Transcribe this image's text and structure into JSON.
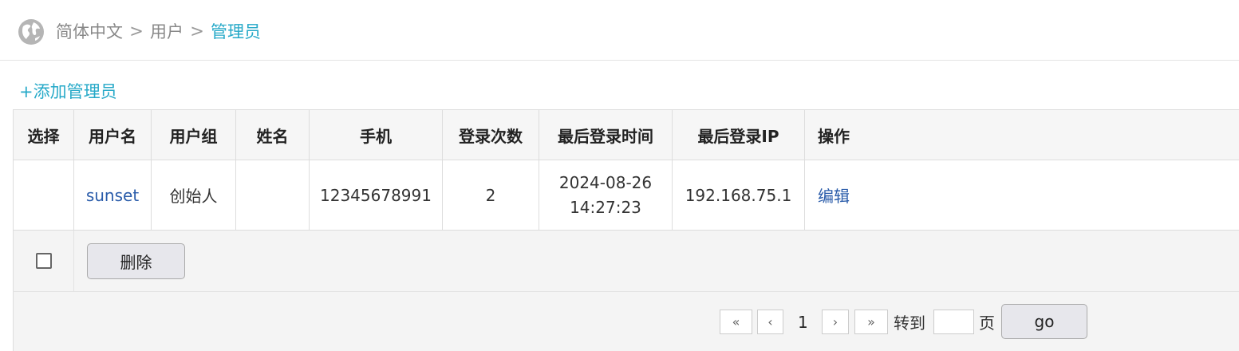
{
  "breadcrumb": {
    "icon": "globe-icon",
    "items": [
      "简体中文",
      "用户",
      "管理员"
    ],
    "separator": ">"
  },
  "add_admin_link": "+添加管理员",
  "table": {
    "headers": [
      "选择",
      "用户名",
      "用户组",
      "姓名",
      "手机",
      "登录次数",
      "最后登录时间",
      "最后登录IP",
      "操作"
    ],
    "rows": [
      {
        "select": "",
        "username": "sunset",
        "group": "创始人",
        "name": "",
        "phone": "12345678991",
        "login_count": "2",
        "last_login_date": "2024-08-26",
        "last_login_time": "14:27:23",
        "last_login_ip": "192.168.75.1",
        "action": "编辑"
      }
    ]
  },
  "bulk": {
    "delete_label": "删除"
  },
  "pager": {
    "first": "«",
    "prev": "‹",
    "current_page": "1",
    "next": "›",
    "last": "»",
    "goto_label": "转到",
    "page_input_value": "",
    "page_unit": "页",
    "go_label": "go"
  },
  "colors": {
    "accent": "#26a9c8",
    "link": "#2a5caa",
    "header_bg": "#f6f6f6",
    "footer_bg": "#f4f4f4"
  }
}
